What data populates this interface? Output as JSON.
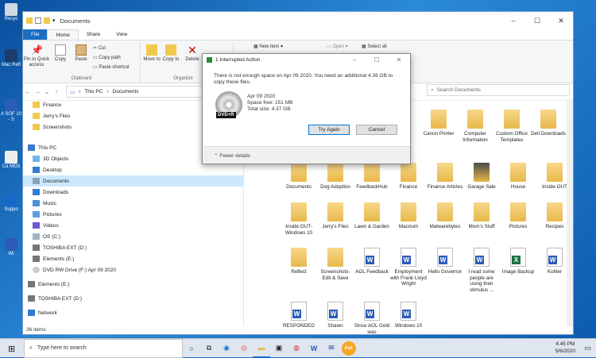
{
  "desktop": {
    "icons": [
      "Recyc",
      "Mac Refl",
      "A SOF 10 - S",
      "Ca MG5",
      "Suppo",
      "Wi"
    ]
  },
  "window": {
    "title": "Documents",
    "controls": {
      "minimize": "–",
      "maximize": "☐",
      "close": "✕"
    },
    "menu": {
      "file": "File",
      "home": "Home",
      "share": "Share",
      "view": "View"
    }
  },
  "ribbon": {
    "pin": "Pin to Quick access",
    "copy": "Copy",
    "paste": "Paste",
    "cut": "Cut",
    "copy_path": "Copy path",
    "paste_shortcut": "Paste shortcut",
    "clipboard": "Clipboard",
    "move_to": "Move to",
    "copy_to": "Copy to",
    "delete": "Delete",
    "organize": "Organize",
    "new_item": "New item",
    "open": "Open",
    "select_all": "Select all"
  },
  "address": {
    "this_pc": "This PC",
    "documents": "Documents",
    "sep": "›",
    "search_placeholder": "Search Documents"
  },
  "nav": {
    "items": [
      "Finance",
      "Jerry's Files",
      "Screenshots",
      "This PC",
      "3D Objects",
      "Desktop",
      "Documents",
      "Downloads",
      "Music",
      "Pictures",
      "Videos",
      "OS (C:)",
      "TOSHIBA EXT (D:)",
      "Elements (E:)",
      "DVD RW Drive (F:) Apr 09 2020",
      "Elements (E:)",
      "TOSHIBA EXT (D:)",
      "Network"
    ]
  },
  "files": {
    "row0": [
      "Canon Printer",
      "Computer Information",
      "Custom Office Templates",
      "Dell Downloads"
    ],
    "row1": [
      "Documents",
      "Dog Adoption",
      "FeedbackHub",
      "Finance",
      "Finance Articles",
      "Garage Sale",
      "House",
      "Inside OUT"
    ],
    "row2": [
      "Inside OUT-Windows 10",
      "Jerry's Files",
      "Lawn & Garden",
      "Macrium",
      "Malwarebytes",
      "Mom's Stuff",
      "Pictures",
      "Recipes"
    ],
    "row3": [
      "Reflect",
      "Screenshots-Edit & Save",
      "AOL Feedback",
      "Employment with Frank Lloyd Wright",
      "Hello Governor",
      "I read some people are using their stimulus ...",
      "Image Backup",
      "Kohler"
    ],
    "row4": [
      "RESPONDED",
      "Shawn",
      "Since AOL Gold was",
      "Windows 10"
    ]
  },
  "status": {
    "count": "36 items"
  },
  "dialog": {
    "title": "1 Interrupted Action",
    "message": "There is not enough space on Apr 09 2020. You need an additional 4.36 GB to copy these files.",
    "drive_label": "DVD+R",
    "drive_name": "Apr 09 2020",
    "space_free": "Space free: 151 MB",
    "total_size": "Total size: 4.37 GB",
    "try_again": "Try Again",
    "cancel": "Cancel",
    "fewer_details": "Fewer details"
  },
  "taskbar": {
    "search_placeholder": "Type here to search",
    "time": "4:45 PM",
    "date": "5/6/2020",
    "aol": "Aol."
  }
}
